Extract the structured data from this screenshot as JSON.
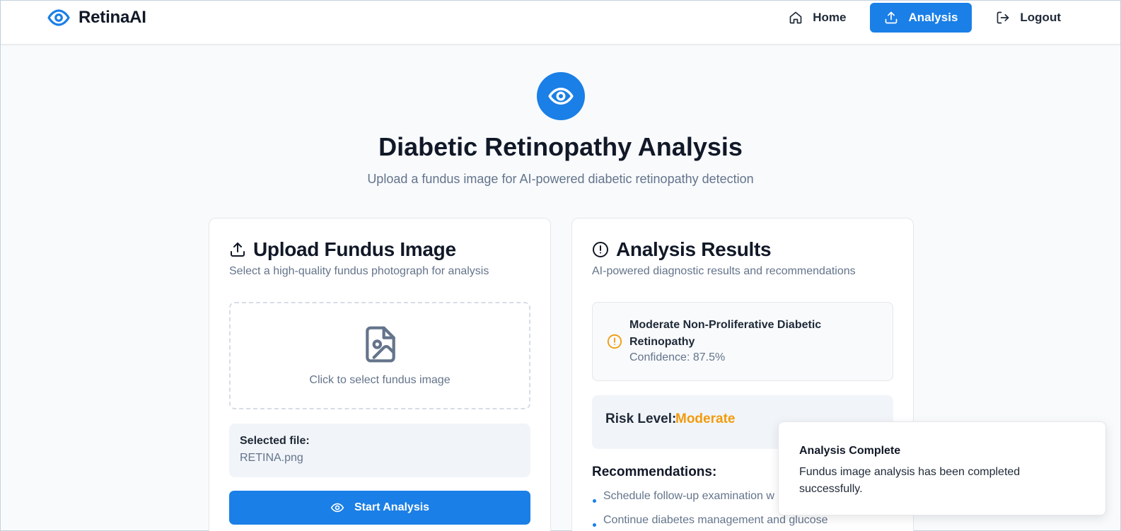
{
  "brand": {
    "name": "RetinaAI",
    "icon": "eye-icon",
    "color": "#1a7fe6"
  },
  "nav": {
    "home": {
      "label": "Home",
      "icon": "home-icon"
    },
    "analysis": {
      "label": "Analysis",
      "icon": "upload-icon",
      "active": true
    },
    "logout": {
      "label": "Logout",
      "icon": "logout-icon"
    }
  },
  "hero": {
    "icon": "eye-icon",
    "title": "Diabetic Retinopathy Analysis",
    "subtitle": "Upload a fundus image for AI-powered diabetic retinopathy detection"
  },
  "upload_card": {
    "icon": "upload-icon",
    "title": "Upload Fundus Image",
    "description": "Select a high-quality fundus photograph for analysis",
    "dropzone_icon": "image-file-icon",
    "dropzone_text": "Click to select fundus image",
    "selected_label": "Selected file:",
    "selected_value": "RETINA.png",
    "start_button": {
      "label": "Start Analysis",
      "icon": "eye-icon"
    }
  },
  "results_card": {
    "icon": "alert-circle-icon",
    "title": "Analysis Results",
    "description": "AI-powered diagnostic results and recommendations",
    "diagnosis": {
      "icon": "warning-circle-icon",
      "name": "Moderate Non-Proliferative Diabetic Retinopathy",
      "confidence": "Confidence: 87.5%",
      "accent": "#f29b0c"
    },
    "risk": {
      "label": "Risk Level:",
      "value": "Moderate",
      "color": "#f29b0c"
    },
    "recommendations_title": "Recommendations:",
    "recommendations": [
      "Schedule follow-up examination w",
      "Continue diabetes management and glucose"
    ]
  },
  "toast": {
    "title": "Analysis Complete",
    "message": "Fundus image analysis has been completed successfully."
  }
}
